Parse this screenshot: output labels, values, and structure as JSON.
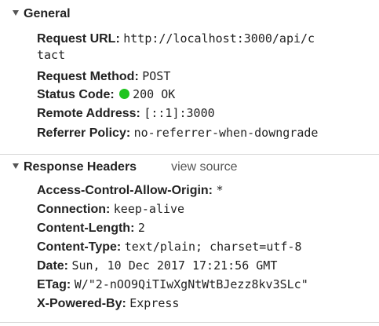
{
  "general": {
    "title": "General",
    "request_url": {
      "key": "Request URL:",
      "value": "http://localhost:3000/api/c",
      "value_wrap": "tact"
    },
    "request_method": {
      "key": "Request Method:",
      "value": "POST"
    },
    "status_code": {
      "key": "Status Code:",
      "value": "200 OK",
      "status_color": "#1fc41f"
    },
    "remote_address": {
      "key": "Remote Address:",
      "value": "[::1]:3000"
    },
    "referrer_policy": {
      "key": "Referrer Policy:",
      "value": "no-referrer-when-downgrade"
    }
  },
  "response_headers": {
    "title": "Response Headers",
    "view_source": "view source",
    "items": [
      {
        "key": "Access-Control-Allow-Origin:",
        "value": "*"
      },
      {
        "key": "Connection:",
        "value": "keep-alive"
      },
      {
        "key": "Content-Length:",
        "value": "2"
      },
      {
        "key": "Content-Type:",
        "value": "text/plain; charset=utf-8"
      },
      {
        "key": "Date:",
        "value": "Sun, 10 Dec 2017 17:21:56 GMT"
      },
      {
        "key": "ETag:",
        "value": "W/\"2-nOO9QiTIwXgNtWtBJezz8kv3SLc\""
      },
      {
        "key": "X-Powered-By:",
        "value": "Express"
      }
    ]
  }
}
